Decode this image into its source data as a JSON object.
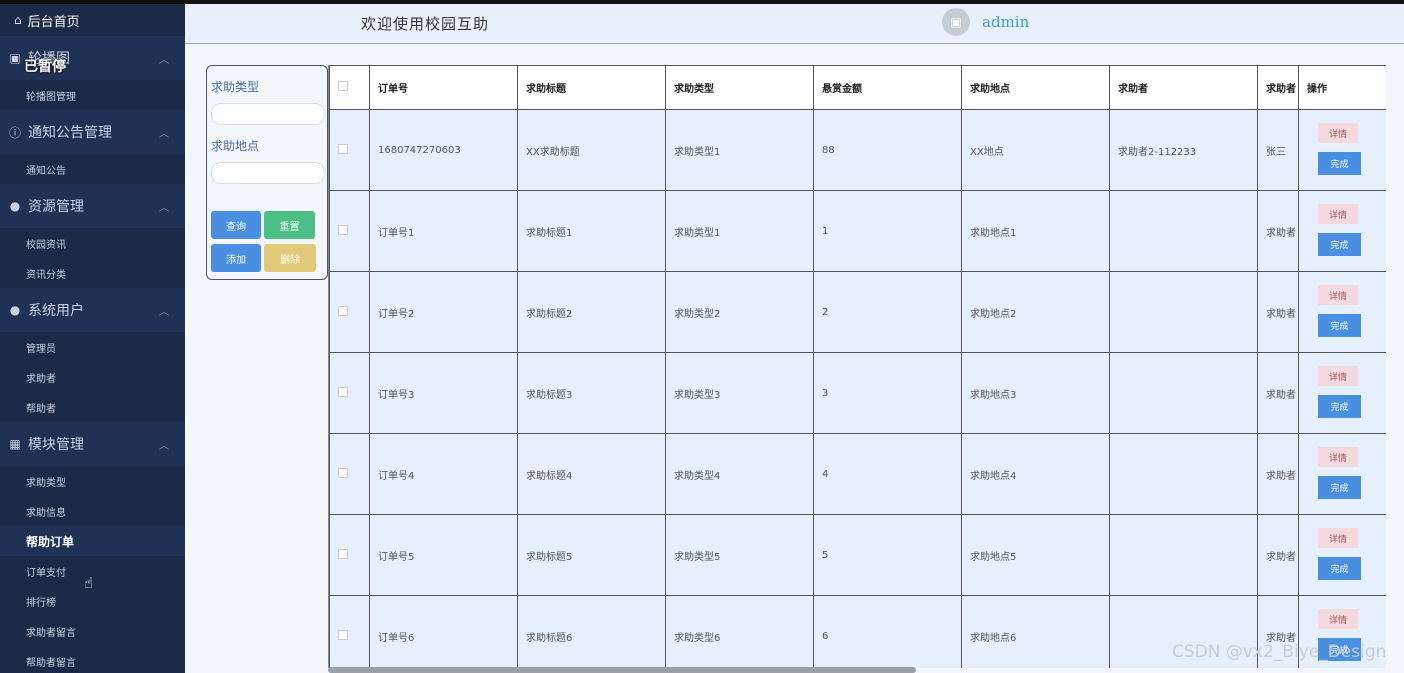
{
  "sidebar": {
    "home": "后台首页",
    "paused_overlay": "已暂停",
    "groups": [
      {
        "label": "轮播图",
        "icon": "image-icon",
        "items": [
          "轮播图管理"
        ]
      },
      {
        "label": "通知公告管理",
        "icon": "info-icon",
        "items": [
          "通知公告"
        ]
      },
      {
        "label": "资源管理",
        "icon": "location-pin-icon",
        "items": [
          "校园资讯",
          "资讯分类"
        ]
      },
      {
        "label": "系统用户",
        "icon": "user-icon",
        "items": [
          "管理员",
          "求助者",
          "帮助者"
        ]
      },
      {
        "label": "模块管理",
        "icon": "grid-icon",
        "items": [
          "求助类型",
          "求助信息",
          "帮助订单",
          "订单支付",
          "排行榜",
          "求助者留言",
          "帮助者留言"
        ]
      }
    ],
    "active_item": "帮助订单"
  },
  "header": {
    "welcome": "欢迎使用校园互助",
    "username": "admin"
  },
  "search": {
    "type_label": "求助类型",
    "place_label": "求助地点",
    "query": "查询",
    "reset": "重置",
    "add": "添加",
    "delete": "删除"
  },
  "table": {
    "columns": [
      "订单号",
      "求助标题",
      "求助类型",
      "悬赏金额",
      "求助地点",
      "求助者",
      "求助者",
      "操作"
    ],
    "rows": [
      [
        "1680747270603",
        "XX求助标题",
        "求助类型1",
        "88",
        "XX地点",
        "求助者2-112233",
        "张三"
      ],
      [
        "订单号1",
        "求助标题1",
        "求助类型1",
        "1",
        "求助地点1",
        "",
        "求助者"
      ],
      [
        "订单号2",
        "求助标题2",
        "求助类型2",
        "2",
        "求助地点2",
        "",
        "求助者"
      ],
      [
        "订单号3",
        "求助标题3",
        "求助类型3",
        "3",
        "求助地点3",
        "",
        "求助者"
      ],
      [
        "订单号4",
        "求助标题4",
        "求助类型4",
        "4",
        "求助地点4",
        "",
        "求助者"
      ],
      [
        "订单号5",
        "求助标题5",
        "求助类型5",
        "5",
        "求助地点5",
        "",
        "求助者"
      ],
      [
        "订单号6",
        "求助标题6",
        "求助类型6",
        "6",
        "求助地点6",
        "",
        "求助者"
      ]
    ],
    "detail_label": "详情",
    "done_label": "完成"
  },
  "watermark": "CSDN @vx2_Biye_Design"
}
